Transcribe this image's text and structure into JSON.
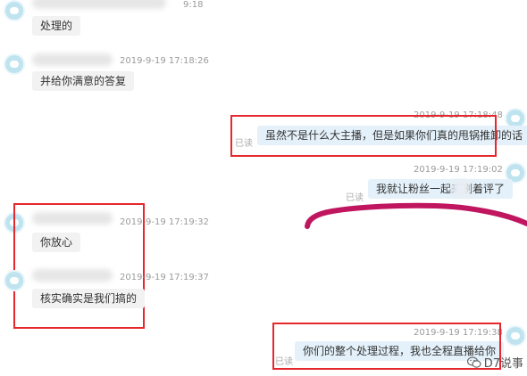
{
  "messages": [
    {
      "time": "9:18",
      "text": "处理的"
    },
    {
      "time": "2019-9-19 17:18:26",
      "text": "并给你满意的答复"
    },
    {
      "time": "2019-9-19 17:18:48",
      "text": "虽然不是什么大主播，但是如果你们真的甩锅推卸的话",
      "status": "已读"
    },
    {
      "time": "2019-9-19 17:19:02",
      "text": "我就让粉丝一起来刷着评了",
      "status": "已读"
    },
    {
      "time": "2019-9-19 17:19:32",
      "text": "你放心"
    },
    {
      "time": "2019-9-19 17:19:37",
      "text": "核实确实是我们搞的"
    },
    {
      "time": "2019-9-19 17:19:38",
      "text": "你们的整个处理过程，我也全程直播给你",
      "status": "已读"
    }
  ],
  "watermark": {
    "text": "D7说事",
    "icon": "wechat-icon"
  },
  "colors": {
    "annotation_red": "#e5282d",
    "scribble": "#c0165f",
    "outgoing_bubble": "#e4f1fa",
    "incoming_bubble": "#f2f2f2"
  }
}
